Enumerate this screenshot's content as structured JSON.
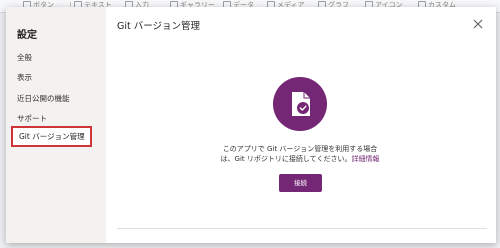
{
  "background_toolbar": {
    "items": [
      "ボタン",
      "テキスト",
      "入力",
      "ギャラリー",
      "データ",
      "メディア",
      "グラフ",
      "アイコン",
      "カスタム"
    ]
  },
  "dialog": {
    "title": "Git バージョン管理",
    "close_icon": "close-icon"
  },
  "sidebar": {
    "title": "設定",
    "items": [
      {
        "label": "全般"
      },
      {
        "label": "表示"
      },
      {
        "label": "近日公開の機能"
      },
      {
        "label": "サポート"
      },
      {
        "label": "Git バージョン管理",
        "selected": true
      }
    ]
  },
  "main": {
    "icon": "git-document-check-icon",
    "message_line1": "このアプリで Git バージョン管理を利用する場合",
    "message_line2": "は、Git リポジトリに接続してください。",
    "learn_more": "詳細情報",
    "connect_label": "接続"
  },
  "colors": {
    "accent": "#742774",
    "highlight_border": "#d13438",
    "sidebar_bg": "#f3f2f1"
  }
}
